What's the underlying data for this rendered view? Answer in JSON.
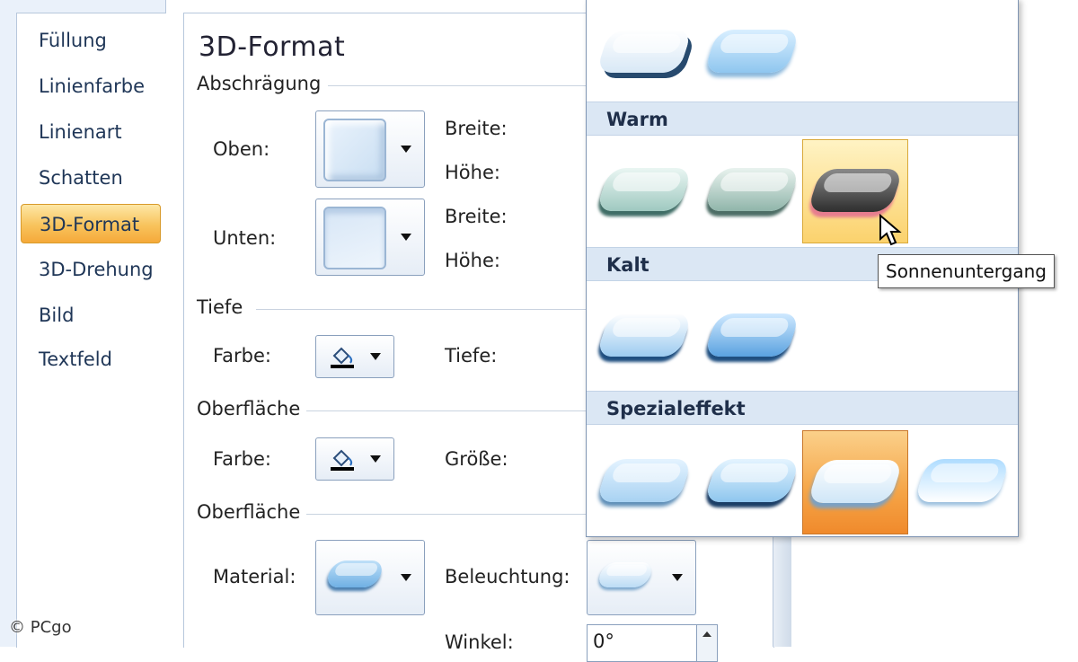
{
  "nav": {
    "items": [
      {
        "label": "Füllung"
      },
      {
        "label": "Linienfarbe"
      },
      {
        "label": "Linienart"
      },
      {
        "label": "Schatten"
      },
      {
        "label": "3D-Format",
        "active": true
      },
      {
        "label": "3D-Drehung"
      },
      {
        "label": "Bild"
      },
      {
        "label": "Textfeld"
      }
    ]
  },
  "panel": {
    "title": "3D-Format",
    "bevel": {
      "heading": "Abschrägung",
      "top_label": "Oben:",
      "bottom_label": "Unten:",
      "width_label_1": "Breite:",
      "height_label_1": "Höhe:",
      "width_label_2": "Breite:",
      "height_label_2": "Höhe:"
    },
    "depth": {
      "heading": "Tiefe",
      "color_label": "Farbe:",
      "depth_label": "Tiefe:"
    },
    "contour": {
      "heading": "Oberfläche",
      "color_label": "Farbe:",
      "size_label": "Größe:"
    },
    "surface": {
      "heading": "Oberfläche",
      "material_label": "Material:",
      "lighting_label": "Beleuchtung:",
      "angle_label": "Winkel:",
      "angle_value": "0°"
    }
  },
  "gallery": {
    "sections": [
      {
        "name": "Warm"
      },
      {
        "name": "Kalt"
      },
      {
        "name": "Spezialeffekt"
      }
    ],
    "tooltip": "Sonnenuntergang"
  },
  "watermark": "© PCgo",
  "colors": {
    "accent_orange": "#f5a93a",
    "section_header_bg": "#dbe7f4",
    "border_blue": "#b7c7dc"
  }
}
